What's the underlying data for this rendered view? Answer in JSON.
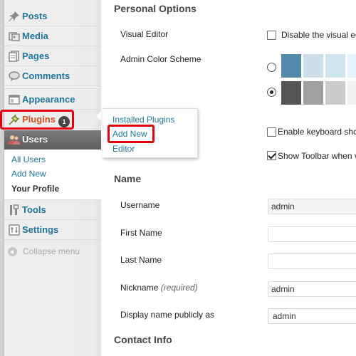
{
  "sidebar": {
    "items": [
      {
        "label": "Posts",
        "icon": "pushpin-icon"
      },
      {
        "label": "Media",
        "icon": "media-icon"
      },
      {
        "label": "Pages",
        "icon": "pages-icon"
      },
      {
        "label": "Comments",
        "icon": "comment-icon"
      },
      {
        "label": "Appearance",
        "icon": "appearance-icon"
      },
      {
        "label": "Plugins",
        "icon": "plugin-icon",
        "badge": "1"
      },
      {
        "label": "Users",
        "icon": "users-icon"
      },
      {
        "label": "Tools",
        "icon": "tools-icon"
      },
      {
        "label": "Settings",
        "icon": "settings-icon"
      }
    ],
    "users_submenu": [
      "All Users",
      "Add New",
      "Your Profile"
    ],
    "collapse_label": "Collapse menu"
  },
  "plugins_flyout": {
    "items": [
      "Installed Plugins",
      "Add New",
      "Editor"
    ]
  },
  "personal_options": {
    "heading": "Personal Options",
    "visual_editor_label": "Visual Editor",
    "visual_editor_checkbox": "Disable the visual ec",
    "visual_editor_checked": false,
    "color_scheme_label": "Admin Color Scheme",
    "color_schemes": [
      {
        "selected": false,
        "colors": [
          "#5589aa",
          "#cfdfe9",
          "#d1e5ee",
          "#e5f3ff"
        ]
      },
      {
        "selected": true,
        "colors": [
          "#555555",
          "#a0a0a0",
          "#cccccc",
          "#f1f1f1"
        ]
      }
    ],
    "keyboard_shortcuts_checkbox": "Enable keyboard shor",
    "keyboard_shortcuts_checked": false,
    "toolbar_checkbox": "Show Toolbar when v",
    "toolbar_checked": true
  },
  "name_section": {
    "heading": "Name",
    "username_label": "Username",
    "username_value": "admin",
    "first_name_label": "First Name",
    "first_name_value": "",
    "last_name_label": "Last Name",
    "last_name_value": "",
    "nickname_label": "Nickname",
    "nickname_required": "(required)",
    "nickname_value": "admin",
    "display_name_label": "Display name publicly as",
    "display_name_value": "admin"
  },
  "contact_section": {
    "heading": "Contact Info"
  },
  "colors": {
    "link": "#21759b",
    "active_plugin": "#d54e21",
    "highlight_box": "#e2000f"
  }
}
